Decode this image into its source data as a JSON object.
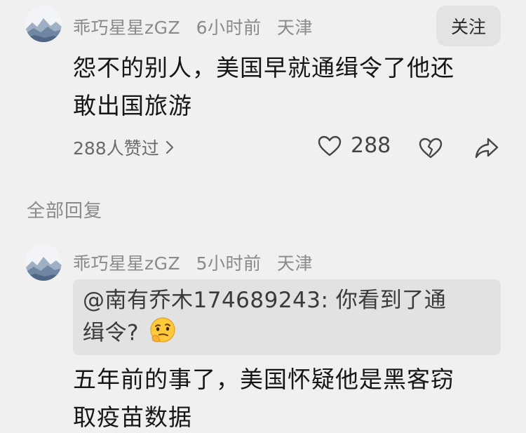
{
  "comment": {
    "username": "乖巧星星zGZ",
    "time": "6小时前",
    "location": "天津",
    "follow_label": "关注",
    "text_line1": "怨不的别人，美国早就通缉令了他还",
    "text_line2": "敢出国旅游",
    "likers_label": "288人赞过",
    "like_count": "288"
  },
  "replies_section_title": "全部回复",
  "reply": {
    "username": "乖巧星星zGZ",
    "time": "5小时前",
    "location": "天津",
    "quote_line1": "@南有乔木174689243: 你看到了通",
    "quote_line2": "缉令?",
    "quote_emoji": "thinking-smirk-emoji",
    "text_line1": "五年前的事了，美国怀疑他是黑客窃",
    "text_line2": "取疫苗数据"
  },
  "colors": {
    "background": "#f0f0f0",
    "meta_text": "#8a8a8a",
    "quote_bg": "#e2e2e2",
    "follow_bg": "#e3e3e3"
  }
}
